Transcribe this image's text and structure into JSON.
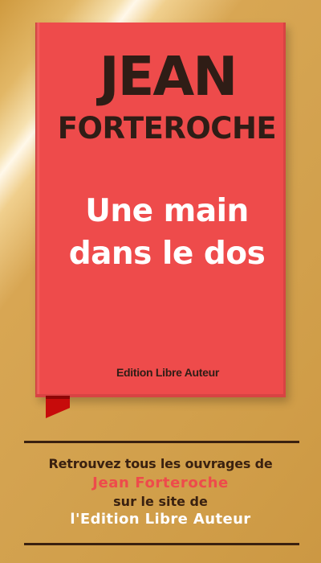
{
  "book": {
    "author_first": "JEAN",
    "author_last": "FORTEROCHE",
    "title_line_1": "Une main",
    "title_line_2": "dans le dos",
    "publisher": "Edition Libre Auteur",
    "cover_color": "#ee4b4b",
    "ribbon_color": "#c70b0b"
  },
  "promo": {
    "line_1": "Retrouvez tous les ouvrages de",
    "line_2": "Jean Forteroche",
    "line_3": "sur  le site de",
    "line_4": "l'Edition Libre Auteur",
    "accent_color": "#ee4b4b",
    "text_color": "#3a2110"
  }
}
